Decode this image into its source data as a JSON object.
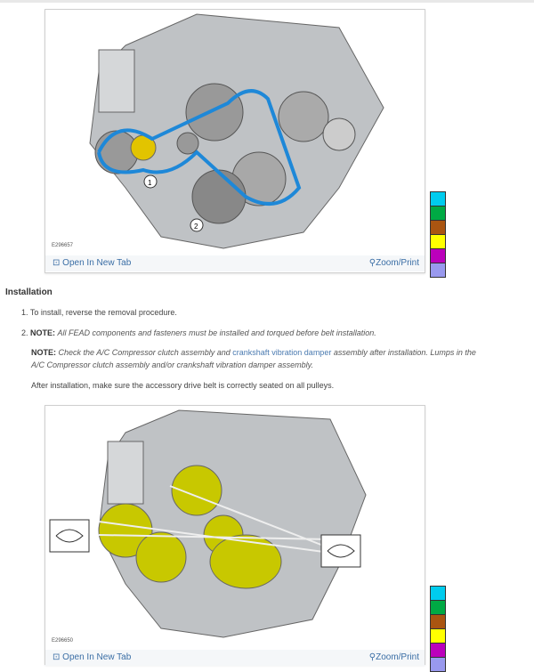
{
  "figures": [
    {
      "id": "E296657",
      "open_label": "Open In New Tab",
      "zoom_label": "Zoom/Print",
      "callouts": [
        "1",
        "2"
      ]
    },
    {
      "id": "E296650",
      "open_label": "Open In New Tab",
      "zoom_label": "Zoom/Print"
    }
  ],
  "swatch_colors": [
    "#00ccee",
    "#00aa44",
    "#aa5511",
    "#ffff00",
    "#bb00bb",
    "#9999ee"
  ],
  "section_title": "Installation",
  "steps": [
    {
      "num": "1.",
      "text": "To install, reverse the removal procedure."
    },
    {
      "num": "2.",
      "note_label": "NOTE:",
      "note_text": "All FEAD components and fasteners must be installed and torqued before belt installation."
    }
  ],
  "note2": {
    "label": "NOTE:",
    "text_a": "Check the A/C Compressor clutch assembly and ",
    "link": "crankshaft vibration damper",
    "text_b": " assembly after installation. Lumps in the",
    "line2": "A/C Compressor clutch assembly and/or crankshaft vibration damper assembly."
  },
  "after_text": "After installation, make sure the accessory drive belt is correctly seated on all pulleys."
}
